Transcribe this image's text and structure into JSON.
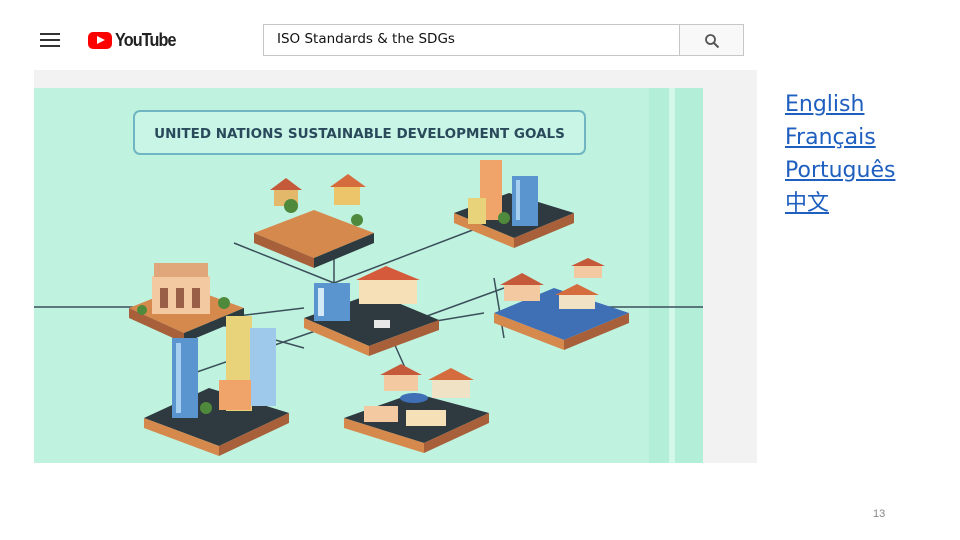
{
  "header": {
    "menu_icon": "hamburger-menu-icon",
    "logo_text": "YouTube",
    "search": {
      "value": "ISO Standards & the SDGs",
      "icon": "search-icon"
    }
  },
  "video": {
    "banner_text": "UNITED NATIONS SUSTAINABLE DEVELOPMENT GOALS",
    "colors": {
      "background": "#bff3e0",
      "accent": "#ff0000"
    }
  },
  "languages": [
    "English",
    "Français",
    "Português",
    "中文"
  ],
  "page_number": "13"
}
